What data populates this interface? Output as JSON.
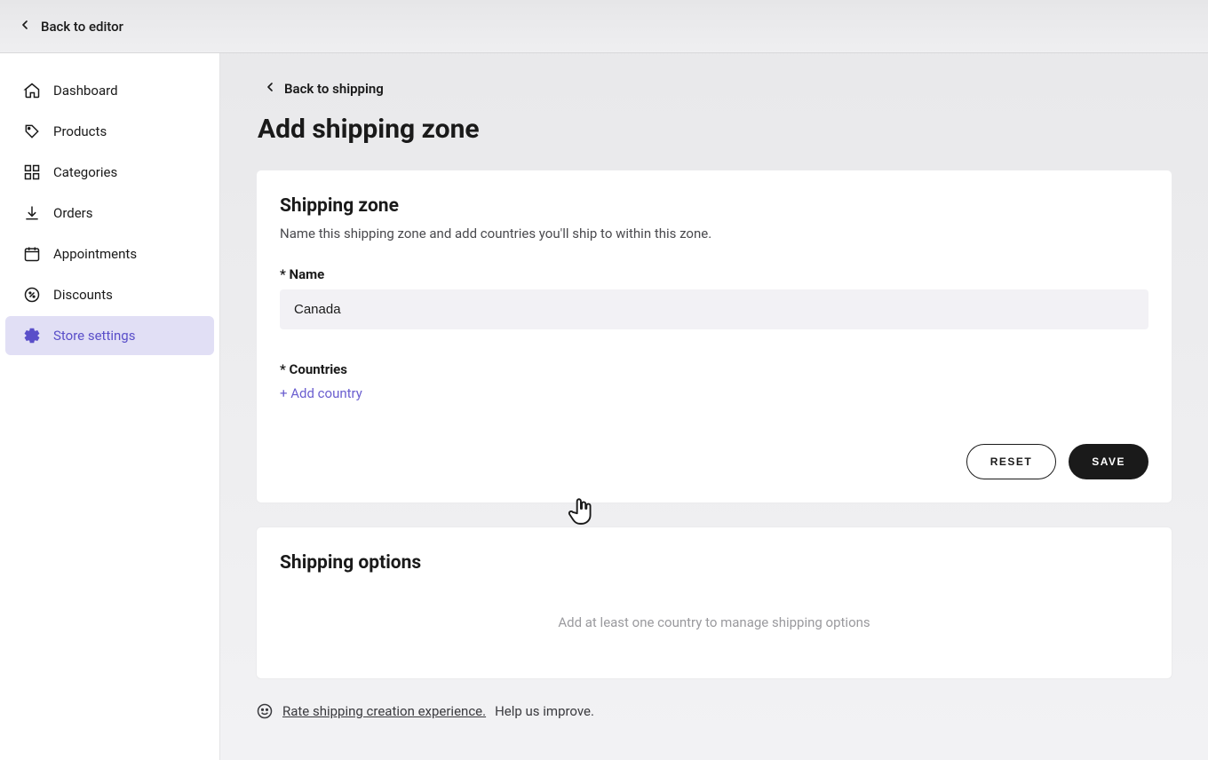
{
  "topbar": {
    "back_label": "Back to editor"
  },
  "sidebar": {
    "items": [
      {
        "label": "Dashboard"
      },
      {
        "label": "Products"
      },
      {
        "label": "Categories"
      },
      {
        "label": "Orders"
      },
      {
        "label": "Appointments"
      },
      {
        "label": "Discounts"
      },
      {
        "label": "Store settings"
      }
    ]
  },
  "main": {
    "back_label": "Back to shipping",
    "page_title": "Add shipping zone",
    "zone_card": {
      "title": "Shipping zone",
      "subtitle": "Name this shipping zone and add countries you'll ship to within this zone.",
      "name_label": "* Name",
      "name_value": "Canada",
      "countries_label": "* Countries",
      "add_country_label": "+ Add country",
      "reset_label": "RESET",
      "save_label": "SAVE"
    },
    "options_card": {
      "title": "Shipping options",
      "empty_text": "Add at least one country to manage shipping options"
    },
    "feedback": {
      "link_text": "Rate shipping creation experience.",
      "help_text": "Help us improve."
    }
  }
}
